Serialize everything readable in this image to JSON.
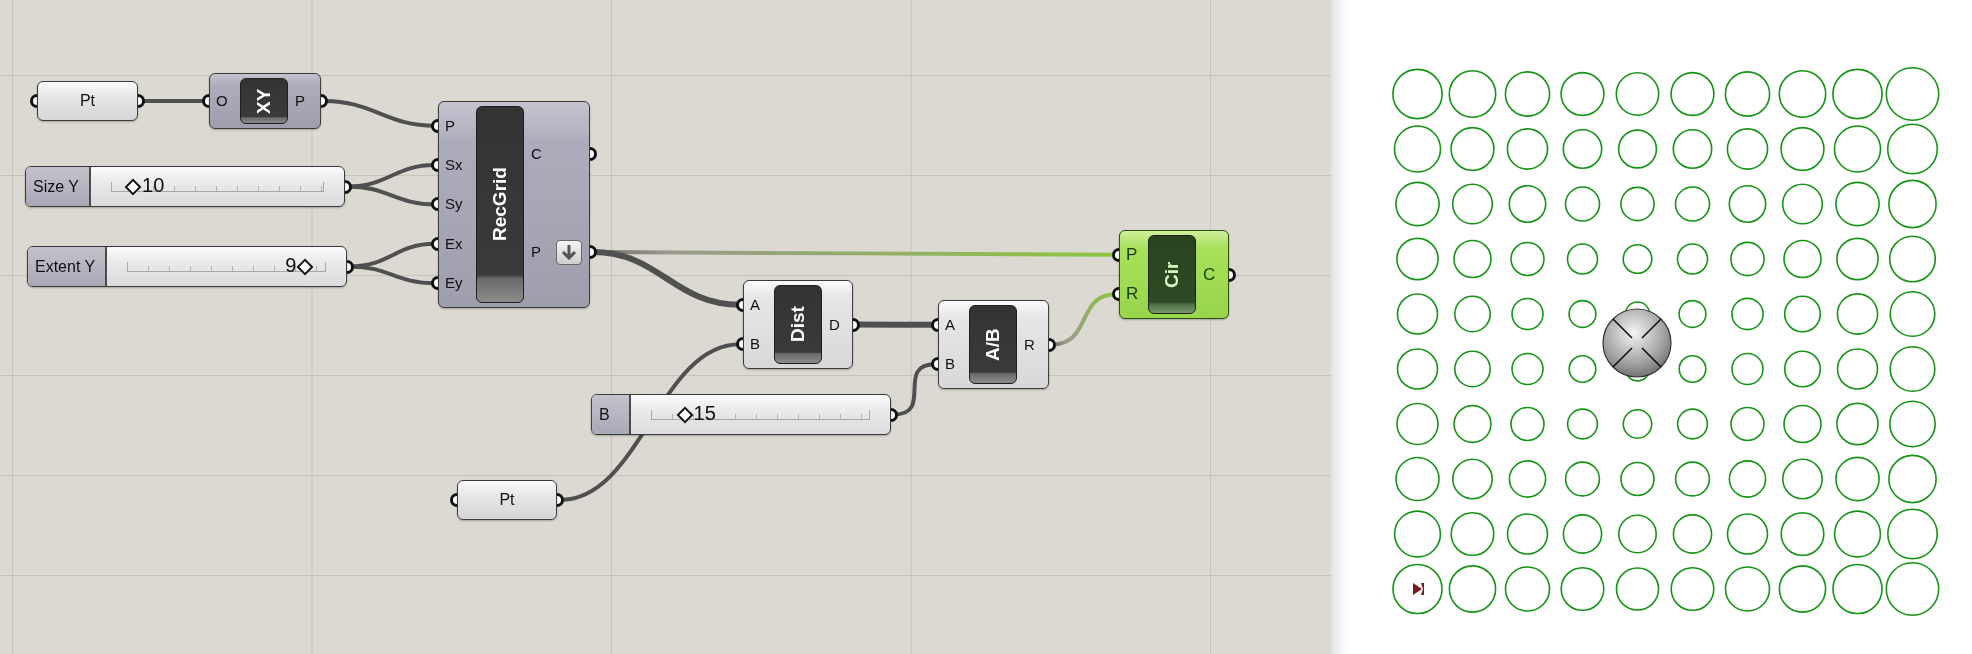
{
  "canvas": {
    "nodes": [
      {
        "kind": "param",
        "label": "Pt",
        "selected": false
      },
      {
        "kind": "component",
        "label": "XY",
        "inputs": [
          "O"
        ],
        "outputs": [
          {
            "label": "P",
            "flatten": false
          }
        ],
        "preview": true,
        "selected": false
      },
      {
        "kind": "component",
        "label": "RecGrid",
        "inputs": [
          "P",
          "Sx",
          "Sy",
          "Ex",
          "Ey"
        ],
        "outputs": [
          {
            "label": "C",
            "flatten": false
          },
          {
            "label": "P",
            "flatten": true
          }
        ],
        "preview": true,
        "selected": false
      },
      {
        "kind": "slider",
        "label": "Size Y",
        "value": "10",
        "level": 0.1,
        "selected": false
      },
      {
        "kind": "slider",
        "label": "Extent Y",
        "value": "9",
        "level": 0.9,
        "selected": false
      },
      {
        "kind": "component",
        "label": "Cir",
        "inputs": [
          "P",
          "R"
        ],
        "outputs": [
          {
            "label": "C",
            "flatten": false
          }
        ],
        "preview": true,
        "selected": true
      },
      {
        "kind": "component",
        "label": "Dist",
        "inputs": [
          "A",
          "B"
        ],
        "outputs": [
          {
            "label": "D",
            "flatten": false
          }
        ],
        "preview": false,
        "selected": false
      },
      {
        "kind": "component",
        "label": "A/B",
        "inputs": [
          "A",
          "B"
        ],
        "outputs": [
          {
            "label": "R",
            "flatten": false
          }
        ],
        "preview": false,
        "selected": false
      },
      {
        "kind": "slider",
        "label": "B",
        "value": "15",
        "level": 0.15,
        "selected": false
      },
      {
        "kind": "param",
        "label": "Pt",
        "selected": false
      }
    ]
  }
}
